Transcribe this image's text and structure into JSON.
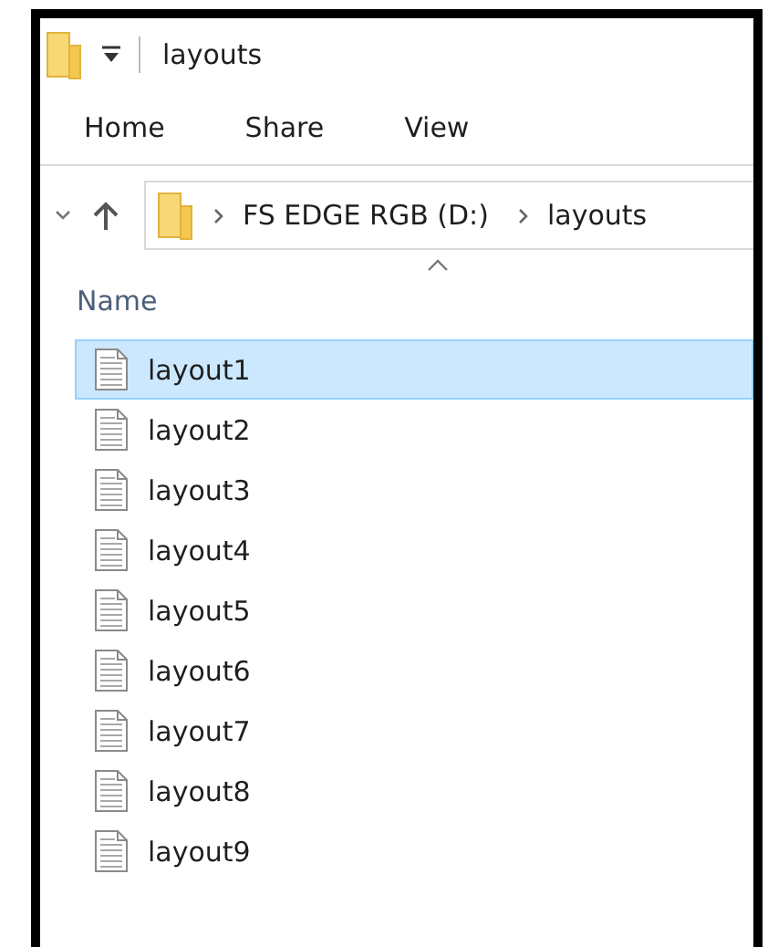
{
  "window": {
    "title": "layouts"
  },
  "ribbon_tabs": [
    {
      "label": "Home",
      "selected": false
    },
    {
      "label": "Share",
      "selected": false
    },
    {
      "label": "View",
      "selected": false
    }
  ],
  "address_bar": {
    "breadcrumbs": [
      "FS EDGE RGB (D:)",
      "layouts"
    ]
  },
  "columns": [
    {
      "label": "Name",
      "sorted_ascending": true
    }
  ],
  "files": [
    {
      "name": "layout1",
      "selected": true
    },
    {
      "name": "layout2",
      "selected": false
    },
    {
      "name": "layout3",
      "selected": false
    },
    {
      "name": "layout4",
      "selected": false
    },
    {
      "name": "layout5",
      "selected": false
    },
    {
      "name": "layout6",
      "selected": false
    },
    {
      "name": "layout7",
      "selected": false
    },
    {
      "name": "layout8",
      "selected": false
    },
    {
      "name": "layout9",
      "selected": false
    }
  ]
}
